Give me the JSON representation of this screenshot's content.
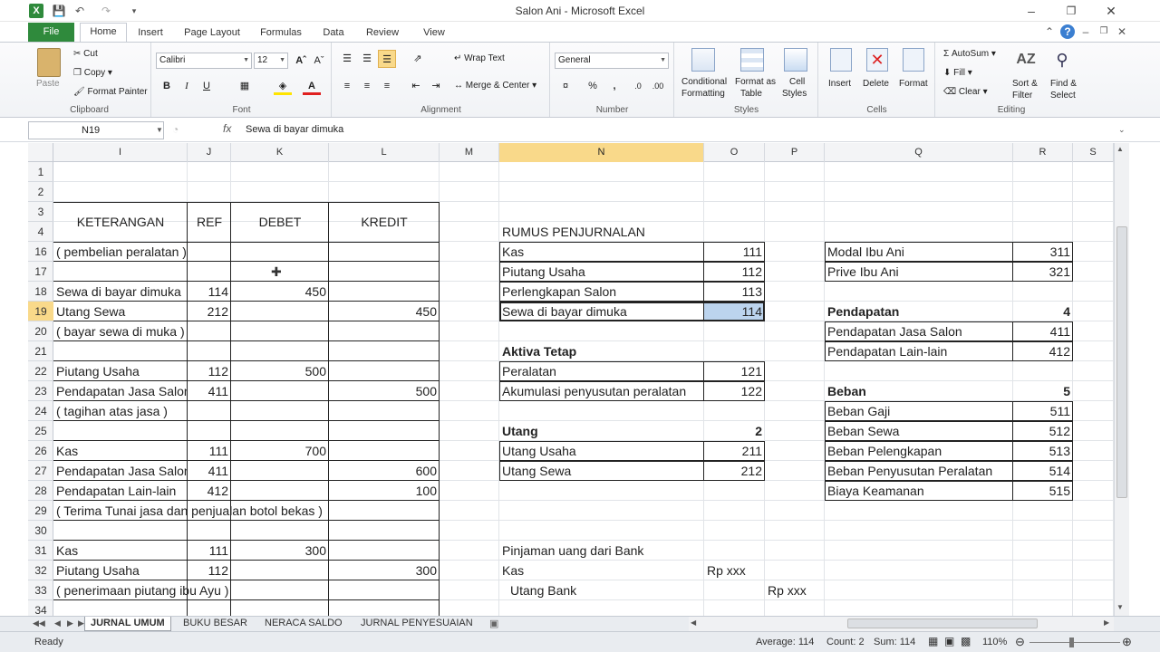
{
  "window": {
    "title": "Salon Ani - Microsoft Excel"
  },
  "tabs": [
    "File",
    "Home",
    "Insert",
    "Page Layout",
    "Formulas",
    "Data",
    "Review",
    "View"
  ],
  "ribbon": {
    "clipboard": {
      "paste": "Paste",
      "cut": "Cut",
      "copy": "Copy",
      "format_painter": "Format Painter",
      "label": "Clipboard"
    },
    "font": {
      "name": "Calibri",
      "size": "12",
      "label": "Font"
    },
    "alignment": {
      "wrap": "Wrap Text",
      "merge": "Merge & Center",
      "label": "Alignment"
    },
    "number": {
      "format": "General",
      "label": "Number"
    },
    "styles": {
      "conditional": "Conditional",
      "conditional2": "Formatting",
      "format_as": "Format as",
      "format_as2": "Table",
      "cell": "Cell",
      "cell2": "Styles",
      "label": "Styles"
    },
    "cells": {
      "insert": "Insert",
      "delete": "Delete",
      "format": "Format",
      "label": "Cells"
    },
    "editing": {
      "autosum": "AutoSum",
      "fill": "Fill",
      "clear": "Clear",
      "sort": "Sort &",
      "sort2": "Filter",
      "find": "Find &",
      "find2": "Select",
      "label": "Editing"
    }
  },
  "formula_bar": {
    "name_box": "N19",
    "fx": "fx",
    "content": "Sewa di bayar dimuka"
  },
  "columns": [
    "I",
    "J",
    "K",
    "L",
    "M",
    "N",
    "O",
    "P",
    "Q",
    "R",
    "S"
  ],
  "rows": [
    "1",
    "2",
    "3",
    "4",
    "16",
    "17",
    "18",
    "19",
    "20",
    "21",
    "22",
    "23",
    "24",
    "25",
    "26",
    "27",
    "28",
    "29",
    "30",
    "31",
    "32",
    "33",
    "34"
  ],
  "journal": {
    "headers": {
      "keterangan": "KETERANGAN",
      "ref": "REF",
      "debet": "DEBET",
      "kredit": "KREDIT"
    },
    "rows": [
      {
        "ket": "( pembelian peralatan )",
        "ref": "",
        "debet": "",
        "kredit": ""
      },
      {
        "ket": "",
        "ref": "",
        "debet": "",
        "kredit": ""
      },
      {
        "ket": "Sewa di bayar dimuka",
        "ref": "114",
        "debet": "450",
        "kredit": ""
      },
      {
        "ket": "Utang Sewa",
        "ref": "212",
        "debet": "",
        "kredit": "450"
      },
      {
        "ket": "( bayar sewa di muka )",
        "ref": "",
        "debet": "",
        "kredit": ""
      },
      {
        "ket": "",
        "ref": "",
        "debet": "",
        "kredit": ""
      },
      {
        "ket": "Piutang Usaha",
        "ref": "112",
        "debet": "500",
        "kredit": ""
      },
      {
        "ket": "Pendapatan Jasa Salon",
        "ref": "411",
        "debet": "",
        "kredit": "500"
      },
      {
        "ket": "( tagihan atas jasa )",
        "ref": "",
        "debet": "",
        "kredit": ""
      },
      {
        "ket": "",
        "ref": "",
        "debet": "",
        "kredit": ""
      },
      {
        "ket": "Kas",
        "ref": "111",
        "debet": "700",
        "kredit": ""
      },
      {
        "ket": "Pendapatan Jasa Salon",
        "ref": "411",
        "debet": "",
        "kredit": "600"
      },
      {
        "ket": "Pendapatan Lain-lain",
        "ref": "412",
        "debet": "",
        "kredit": "100"
      },
      {
        "ket": "( Terima Tunai jasa dan penjualan botol bekas )",
        "ref": "",
        "debet": "",
        "kredit": ""
      },
      {
        "ket": "",
        "ref": "",
        "debet": "",
        "kredit": ""
      },
      {
        "ket": "Kas",
        "ref": "111",
        "debet": "300",
        "kredit": ""
      },
      {
        "ket": "Piutang Usaha",
        "ref": "112",
        "debet": "",
        "kredit": "300"
      },
      {
        "ket": "( penerimaan piutang ibu Ayu )",
        "ref": "",
        "debet": "",
        "kredit": ""
      },
      {
        "ket": "",
        "ref": "",
        "debet": "",
        "kredit": ""
      }
    ]
  },
  "accounts": {
    "title": "RUMUS PENJURNALAN",
    "aset_lancar": [
      {
        "name": "Kas",
        "code": "111"
      },
      {
        "name": "Piutang Usaha",
        "code": "112"
      },
      {
        "name": "Perlengkapan Salon",
        "code": "113"
      },
      {
        "name": "Sewa di bayar dimuka",
        "code": "114"
      }
    ],
    "aktiva_tetap": {
      "title": "Aktiva Tetap",
      "items": [
        {
          "name": "Peralatan",
          "code": "121"
        },
        {
          "name": "Akumulasi penyusutan peralatan",
          "code": "122"
        }
      ]
    },
    "utang": {
      "title": "Utang",
      "code": "2",
      "items": [
        {
          "name": "Utang Usaha",
          "code": "211"
        },
        {
          "name": "Utang Sewa",
          "code": "212"
        }
      ]
    },
    "modal": [
      {
        "name": "Modal Ibu Ani",
        "code": "311"
      },
      {
        "name": "Prive Ibu Ani",
        "code": "321"
      }
    ],
    "pendapatan": {
      "title": "Pendapatan",
      "code": "4",
      "items": [
        {
          "name": "Pendapatan Jasa Salon",
          "code": "411"
        },
        {
          "name": "Pendapatan Lain-lain",
          "code": "412"
        }
      ]
    },
    "beban": {
      "title": "Beban",
      "code": "5",
      "items": [
        {
          "name": "Beban Gaji",
          "code": "511"
        },
        {
          "name": "Beban Sewa",
          "code": "512"
        },
        {
          "name": "Beban Pelengkapan",
          "code": "513"
        },
        {
          "name": "Beban Penyusutan Peralatan",
          "code": "514"
        },
        {
          "name": "Biaya Keamanan",
          "code": "515"
        }
      ]
    },
    "pinjaman": {
      "title": "Pinjaman uang dari Bank",
      "kas": "Kas",
      "kas_val": "Rp xxx",
      "utang_bank": "Utang Bank",
      "utang_val": "Rp xxx"
    }
  },
  "sheets": [
    "JURNAL UMUM",
    "BUKU BESAR",
    "NERACA SALDO",
    "JURNAL PENYESUAIAN"
  ],
  "status": {
    "ready": "Ready",
    "average": "Average: 114",
    "count": "Count: 2",
    "sum": "Sum: 114",
    "zoom": "110%"
  },
  "colors": {
    "file_tab": "#2f8a3c",
    "selected_header": "#f9d98a",
    "selected_cell": "#bcd4ee"
  }
}
